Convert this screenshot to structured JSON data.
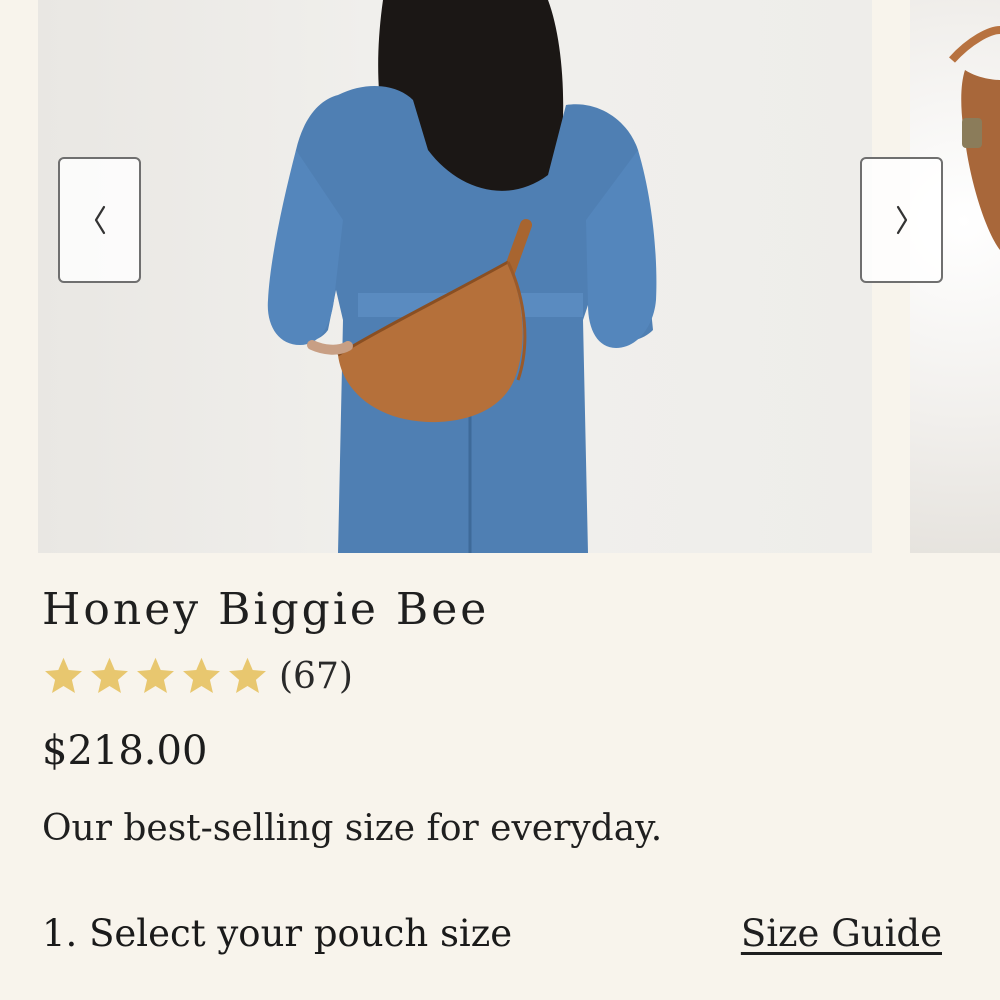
{
  "carousel": {
    "main_image": {
      "alt_icon": "product-photo",
      "bag_color": "#b5703a",
      "denim_color": "#4f7fb3"
    },
    "next_image": {
      "alt_icon": "product-photo-detail"
    },
    "prev_label": "‹",
    "next_label": "›"
  },
  "product": {
    "title": "Honey Biggie Bee",
    "rating": 5,
    "rating_max": 5,
    "review_count": "(67)",
    "price": "$218.00",
    "tagline": "Our best-selling size for everyday."
  },
  "options": {
    "step_label": "1. Select your pouch size",
    "size_guide_label": "Size Guide"
  },
  "colors": {
    "background": "#f8f4ec",
    "star": "#e8c76f",
    "text": "#1d1d1d",
    "button_border": "#6f6f6f"
  }
}
